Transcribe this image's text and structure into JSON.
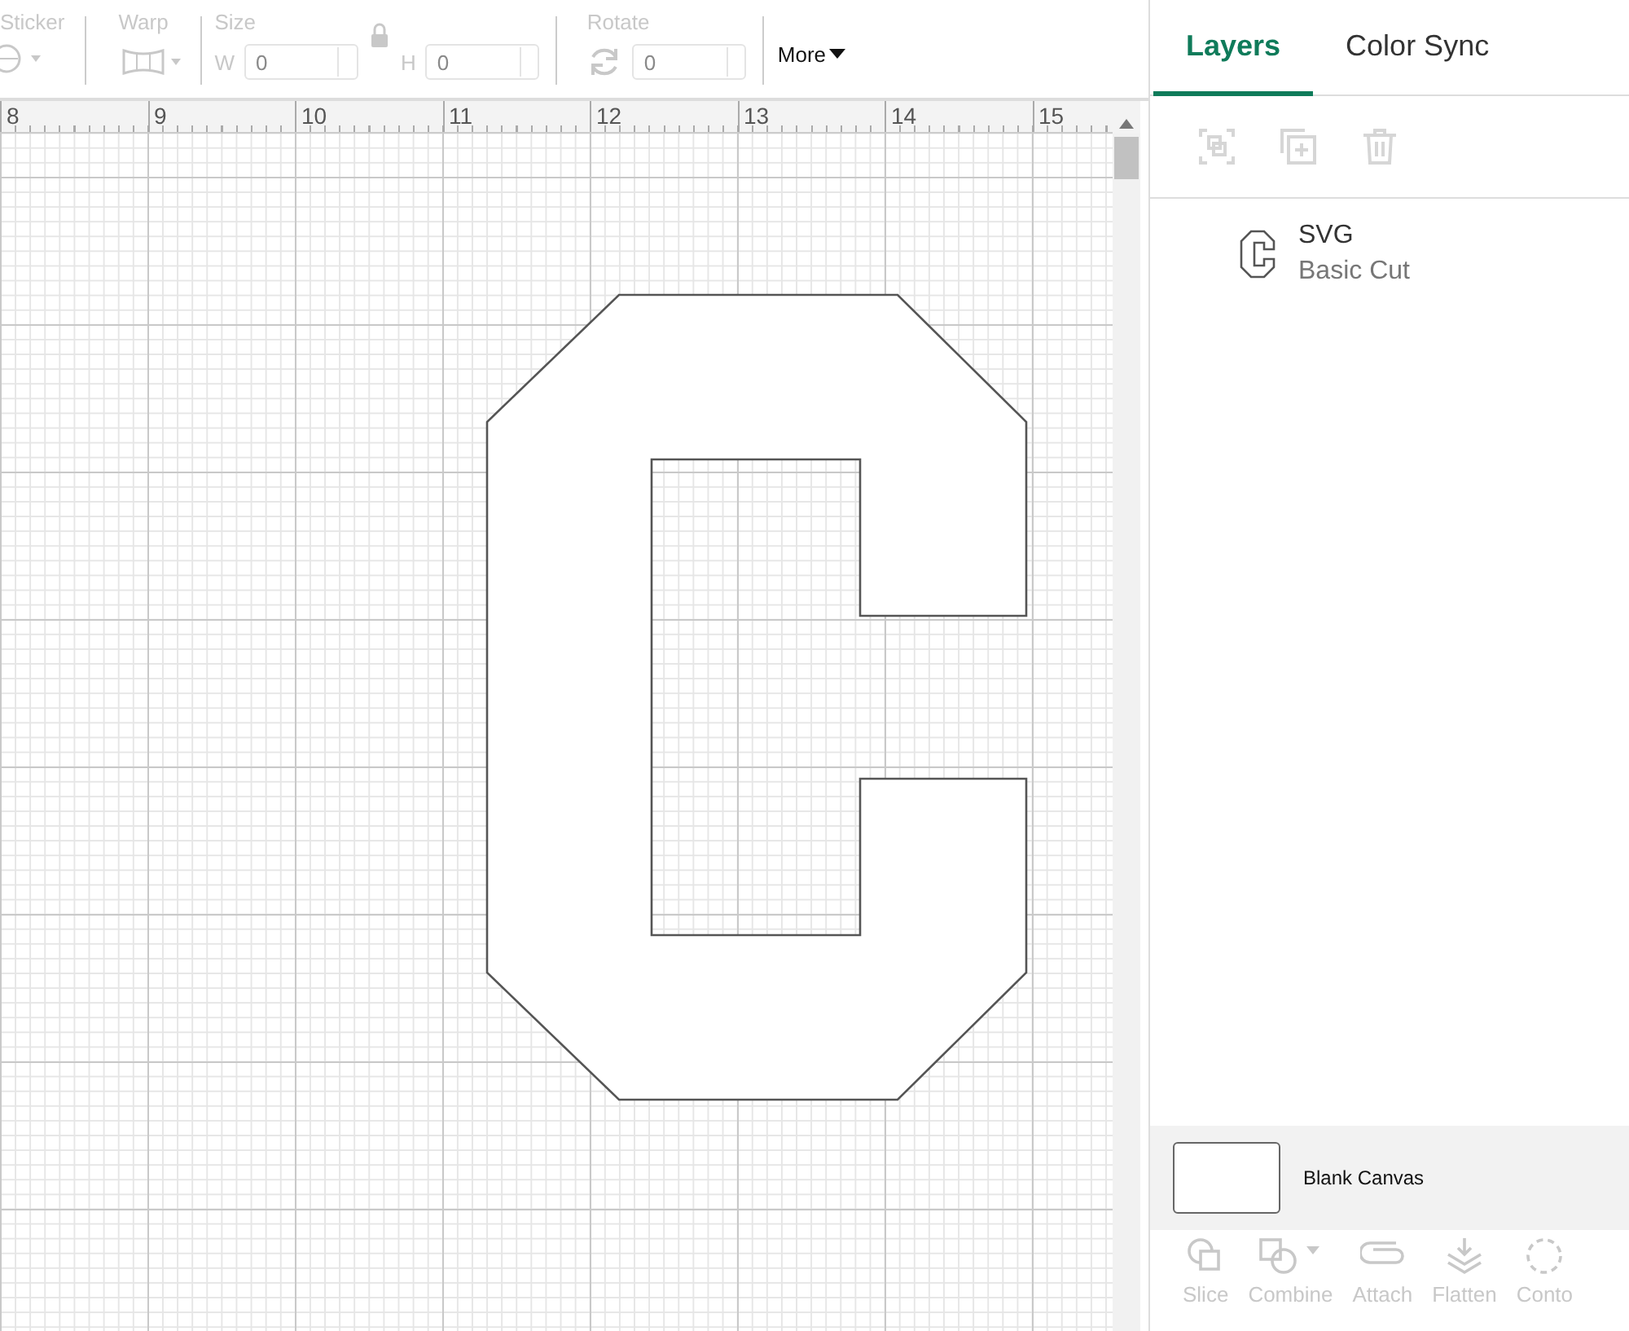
{
  "toolbar": {
    "groups": [
      {
        "kind": "sticker",
        "label": "Sticker",
        "disabled": true
      },
      {
        "kind": "warp",
        "label": "Warp",
        "disabled": true
      },
      {
        "kind": "size",
        "label": "Size",
        "disabled": true,
        "width_label": "W",
        "width_value": "0",
        "height_label": "H",
        "height_value": "0"
      },
      {
        "kind": "rotate",
        "label": "Rotate",
        "disabled": true,
        "value": "0"
      },
      {
        "kind": "more",
        "label": "More",
        "disabled": false
      }
    ]
  },
  "ruler": {
    "marks": [
      "8",
      "9",
      "10",
      "11",
      "12",
      "13",
      "14",
      "15"
    ]
  },
  "panel": {
    "tabs": [
      {
        "label": "Layers",
        "selected": true
      },
      {
        "label": "Color Sync",
        "selected": false
      }
    ],
    "actions": [
      {
        "kind": "group",
        "disabled": true
      },
      {
        "kind": "duplicate",
        "disabled": true
      },
      {
        "kind": "delete",
        "disabled": true
      }
    ],
    "layers": [
      {
        "name": "SVG",
        "operation": "Basic Cut"
      }
    ],
    "canvas_item": {
      "label": "Blank Canvas"
    },
    "tools": [
      {
        "kind": "slice",
        "label": "Slice",
        "disabled": true
      },
      {
        "kind": "combine",
        "label": "Combine",
        "disabled": true
      },
      {
        "kind": "attach",
        "label": "Attach",
        "disabled": true
      },
      {
        "kind": "flatten",
        "label": "Flatten",
        "disabled": true
      },
      {
        "kind": "contour",
        "label": "Conto",
        "disabled": true
      }
    ]
  }
}
